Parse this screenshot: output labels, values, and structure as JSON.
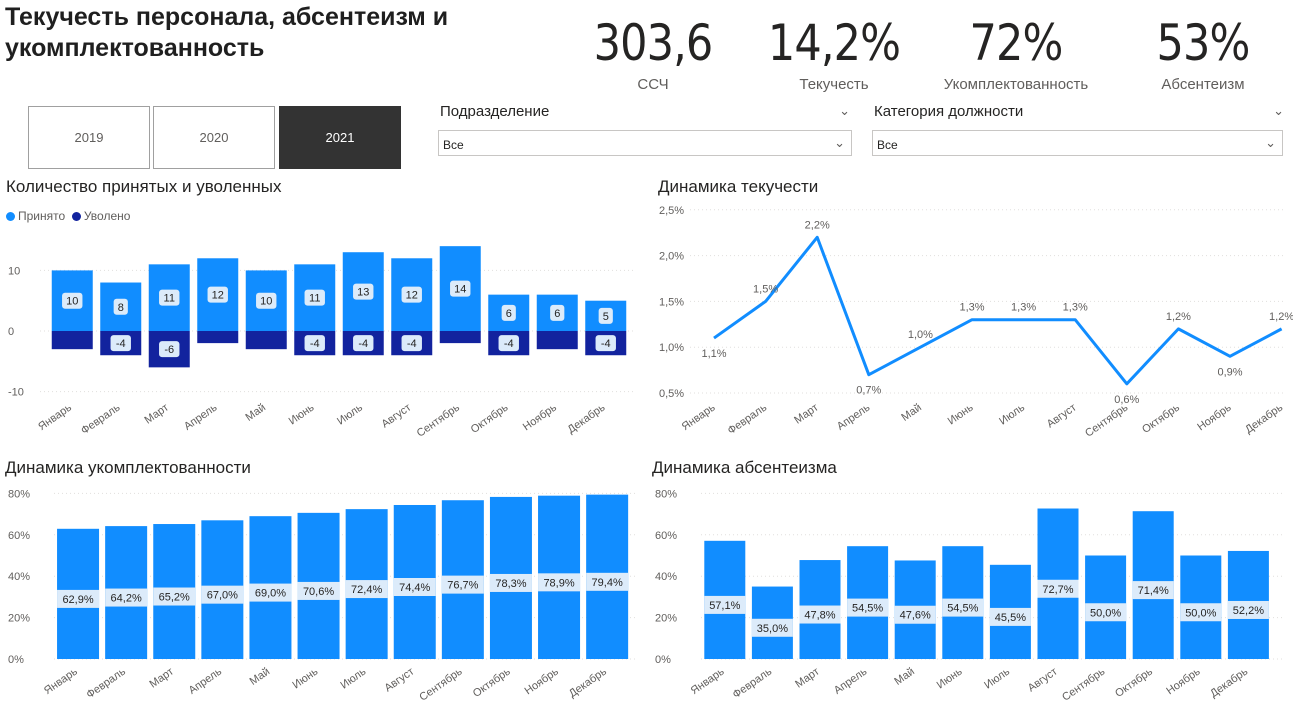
{
  "title": "Текучесть персонала, абсентеизм и укомплектованность",
  "kpis": [
    {
      "value": "303,6",
      "label": "ССЧ"
    },
    {
      "value": "14,2%",
      "label": "Текучесть"
    },
    {
      "value": "72%",
      "label": "Укомплектованность"
    },
    {
      "value": "53%",
      "label": "Абсентеизм"
    }
  ],
  "years": [
    "2019",
    "2020",
    "2021"
  ],
  "selected_year": "2021",
  "filters": {
    "division": {
      "label": "Подразделение",
      "value": "Все"
    },
    "category": {
      "label": "Категория должности",
      "value": "Все"
    }
  },
  "colors": {
    "accent": "#118DFF",
    "dark": "#12239E",
    "label_bg": "#DCEBFA",
    "active_year": "#333333"
  },
  "icons": {
    "chevron": "chevron-down-icon"
  },
  "chart_data": [
    {
      "id": "hires",
      "type": "bar",
      "title": "Количество принятых и уволенных",
      "categories": [
        "Январь",
        "Февраль",
        "Март",
        "Апрель",
        "Май",
        "Июнь",
        "Июль",
        "Август",
        "Сентябрь",
        "Октябрь",
        "Ноябрь",
        "Декабрь"
      ],
      "series": [
        {
          "name": "Принято",
          "values": [
            10,
            8,
            11,
            12,
            10,
            11,
            13,
            12,
            14,
            6,
            6,
            5
          ],
          "labels": [
            "10",
            "8",
            "11",
            "12",
            "10",
            "11",
            "13",
            "12",
            "14",
            "6",
            "6",
            "5"
          ]
        },
        {
          "name": "Уволено",
          "values": [
            -3,
            -4,
            -6,
            -2,
            -3,
            -4,
            -4,
            -4,
            -2,
            -4,
            -3,
            -4
          ],
          "labels": [
            "",
            "-4",
            "-6",
            "",
            "",
            "-4",
            "-4",
            "-4",
            "",
            "-4",
            "",
            "-4"
          ]
        }
      ],
      "yticks": [
        "10",
        "0",
        "-10"
      ],
      "ytick_values": [
        10,
        0,
        -10
      ],
      "ylim": [
        -10,
        15
      ],
      "legend": "top-left",
      "grid": true
    },
    {
      "id": "turnover",
      "type": "line",
      "title": "Динамика текучести",
      "categories": [
        "Январь",
        "Февраль",
        "Март",
        "Апрель",
        "Май",
        "Июнь",
        "Июль",
        "Август",
        "Сентябрь",
        "Октябрь",
        "Ноябрь",
        "Декабрь"
      ],
      "values": [
        1.1,
        1.5,
        2.2,
        0.7,
        1.0,
        1.3,
        1.3,
        1.3,
        0.6,
        1.2,
        0.9,
        1.2
      ],
      "labels": [
        "1,1%",
        "1,5%",
        "2,2%",
        "0,7%",
        "1,0%",
        "1,3%",
        "1,3%",
        "1,3%",
        "0,6%",
        "1,2%",
        "0,9%",
        "1,2%"
      ],
      "yticks": [
        "2,5%",
        "2,0%",
        "1,5%",
        "1,0%",
        "0,5%"
      ],
      "ytick_values": [
        2.5,
        2.0,
        1.5,
        1.0,
        0.5
      ],
      "ylim": [
        0.5,
        2.5
      ],
      "grid": true
    },
    {
      "id": "staffing",
      "type": "bar",
      "title": "Динамика укомплектованности",
      "categories": [
        "Январь",
        "Февраль",
        "Март",
        "Апрель",
        "Май",
        "Июнь",
        "Июль",
        "Август",
        "Сентябрь",
        "Октябрь",
        "Ноябрь",
        "Декабрь"
      ],
      "values": [
        62.9,
        64.2,
        65.2,
        67.0,
        69.0,
        70.6,
        72.4,
        74.4,
        76.7,
        78.3,
        78.9,
        79.4
      ],
      "labels": [
        "62,9%",
        "64,2%",
        "65,2%",
        "67,0%",
        "69,0%",
        "70,6%",
        "72,4%",
        "74,4%",
        "76,7%",
        "78,3%",
        "78,9%",
        "79,4%"
      ],
      "yticks": [
        "80%",
        "60%",
        "40%",
        "20%",
        "0%"
      ],
      "ytick_values": [
        80,
        60,
        40,
        20,
        0
      ],
      "ylim": [
        0,
        80
      ],
      "grid": true
    },
    {
      "id": "absence",
      "type": "bar",
      "title": "Динамика абсентеизма",
      "categories": [
        "Январь",
        "Февраль",
        "Март",
        "Апрель",
        "Май",
        "Июнь",
        "Июль",
        "Август",
        "Сентябрь",
        "Октябрь",
        "Ноябрь",
        "Декабрь"
      ],
      "values": [
        57.1,
        35.0,
        47.8,
        54.5,
        47.6,
        54.5,
        45.5,
        72.7,
        50.0,
        71.4,
        50.0,
        52.2
      ],
      "labels": [
        "57,1%",
        "35,0%",
        "47,8%",
        "54,5%",
        "47,6%",
        "54,5%",
        "45,5%",
        "72,7%",
        "50,0%",
        "71,4%",
        "50,0%",
        "52,2%"
      ],
      "yticks": [
        "80%",
        "60%",
        "40%",
        "20%",
        "0%"
      ],
      "ytick_values": [
        80,
        60,
        40,
        20,
        0
      ],
      "ylim": [
        0,
        80
      ],
      "grid": true
    }
  ]
}
